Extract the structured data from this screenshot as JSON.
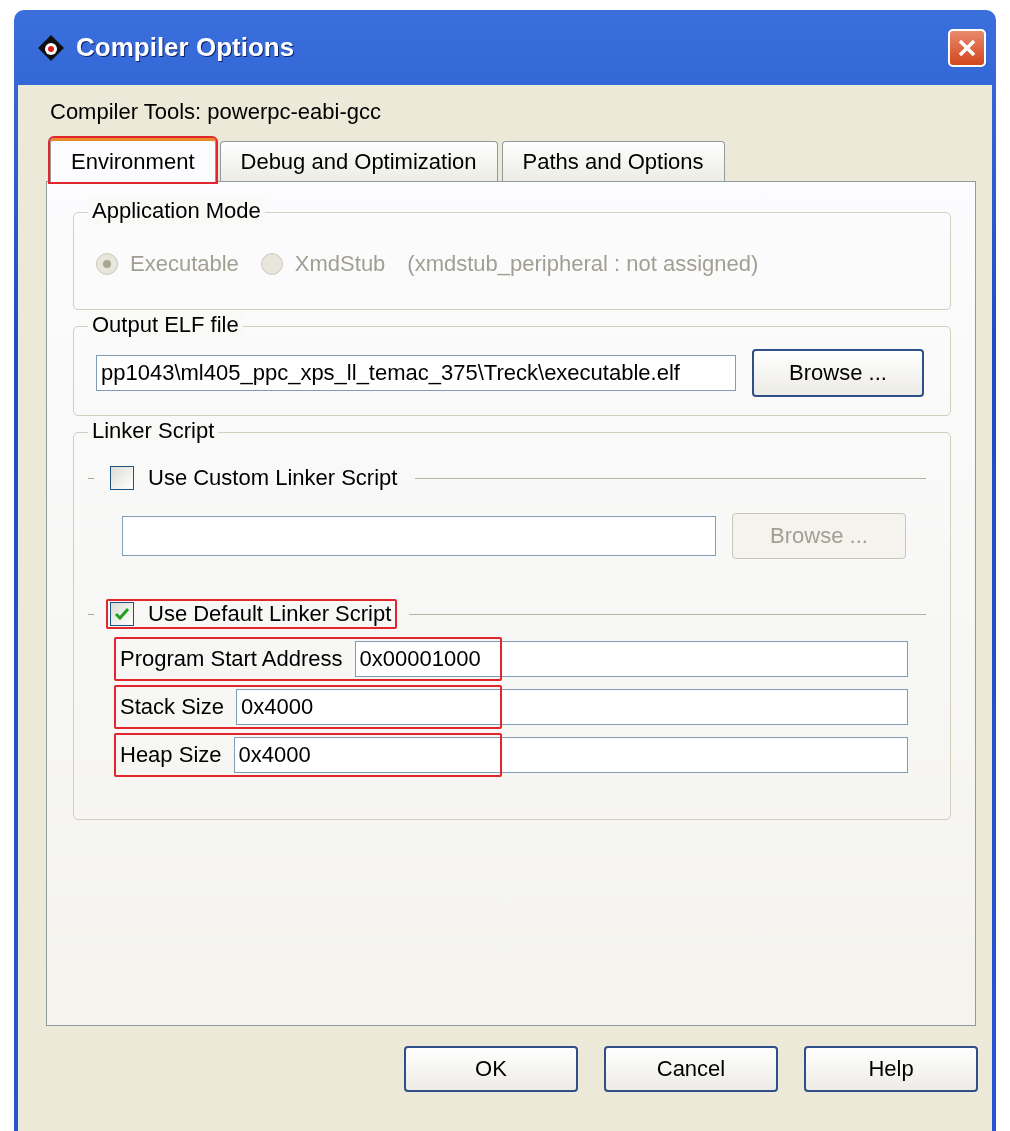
{
  "window": {
    "title": "Compiler Options"
  },
  "compiler_tools": "Compiler Tools: powerpc-eabi-gcc",
  "tabs": [
    {
      "label": "Environment",
      "selected": true,
      "highlighted": true
    },
    {
      "label": "Debug and Optimization",
      "selected": false,
      "highlighted": false
    },
    {
      "label": "Paths and Options",
      "selected": false,
      "highlighted": false
    }
  ],
  "application_mode": {
    "title": "Application Mode",
    "options": [
      {
        "label": "Executable",
        "selected": true,
        "disabled": true
      },
      {
        "label": "XmdStub",
        "selected": false,
        "disabled": true
      }
    ],
    "note": "(xmdstub_peripheral : not assigned)"
  },
  "output_elf": {
    "title": "Output ELF file",
    "value": "pp1043\\ml405_ppc_xps_ll_temac_375\\Treck\\executable.elf",
    "button": "Browse ..."
  },
  "linker_script": {
    "title": "Linker Script",
    "custom": {
      "label": "Use Custom Linker Script",
      "checked": false,
      "highlighted": false
    },
    "custom_browse": {
      "label": "Browse ...",
      "disabled": true
    },
    "default": {
      "label": "Use Default Linker Script",
      "checked": true,
      "highlighted": true
    },
    "fields": [
      {
        "label": "Program Start Address",
        "value": "0x00001000",
        "highlighted": true
      },
      {
        "label": "Stack Size",
        "value": "0x4000",
        "highlighted": true
      },
      {
        "label": "Heap Size",
        "value": "0x4000",
        "highlighted": true
      }
    ]
  },
  "buttons": [
    "OK",
    "Cancel",
    "Help"
  ]
}
